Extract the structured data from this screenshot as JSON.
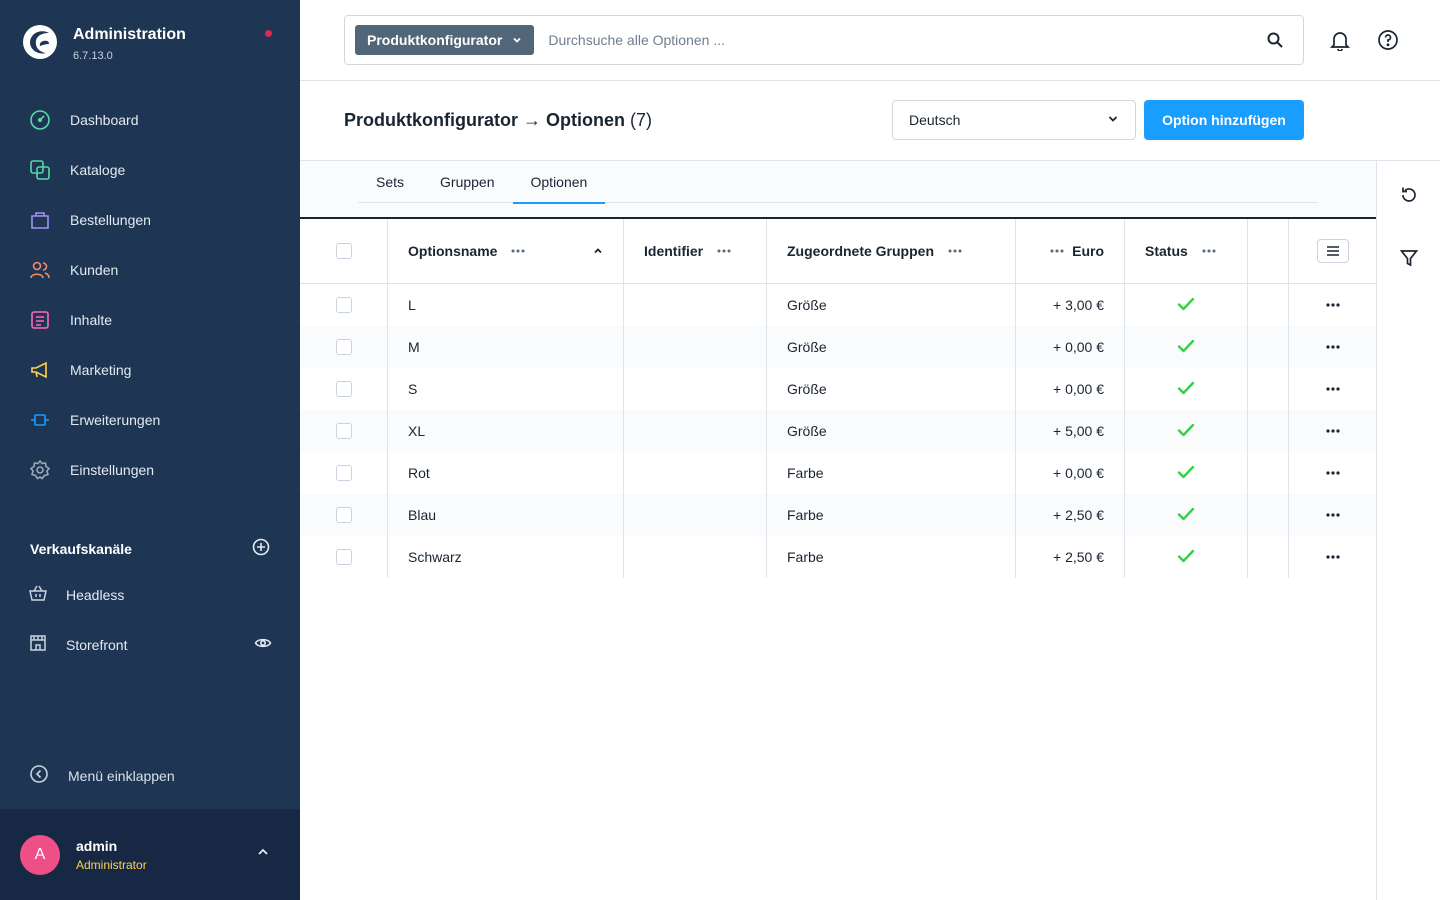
{
  "app": {
    "title": "Administration",
    "version": "6.7.13.0"
  },
  "nav": [
    {
      "label": "Dashboard",
      "icon": "dashboard-icon",
      "color": "#57d9a3"
    },
    {
      "label": "Kataloge",
      "icon": "catalog-icon",
      "color": "#57d9a3"
    },
    {
      "label": "Bestellungen",
      "icon": "orders-icon",
      "color": "#a092f0"
    },
    {
      "label": "Kunden",
      "icon": "customers-icon",
      "color": "#f88962"
    },
    {
      "label": "Inhalte",
      "icon": "content-icon",
      "color": "#ff68b4"
    },
    {
      "label": "Marketing",
      "icon": "marketing-icon",
      "color": "#ffd24a"
    },
    {
      "label": "Erweiterungen",
      "icon": "extensions-icon",
      "color": "#189eff"
    },
    {
      "label": "Einstellungen",
      "icon": "settings-icon",
      "color": "#9aa8b5"
    }
  ],
  "sales_channels": {
    "title": "Verkaufskanäle",
    "items": [
      {
        "label": "Headless"
      },
      {
        "label": "Storefront"
      }
    ]
  },
  "collapse_label": "Menü einklappen",
  "user": {
    "initial": "A",
    "name": "admin",
    "role": "Administrator"
  },
  "search": {
    "type_label": "Produktkonfigurator",
    "placeholder": "Durchsuche alle Optionen ..."
  },
  "page": {
    "title": "Produktkonfigurator → Optionen",
    "count": "(7)",
    "language": "Deutsch",
    "add_button": "Option hinzufügen"
  },
  "tabs": [
    {
      "label": "Sets",
      "active": false
    },
    {
      "label": "Gruppen",
      "active": false
    },
    {
      "label": "Optionen",
      "active": true
    }
  ],
  "table": {
    "columns": {
      "name": "Optionsname",
      "identifier": "Identifier",
      "groups": "Zugeordnete Gruppen",
      "price": "Euro",
      "status": "Status"
    },
    "rows": [
      {
        "name": "L",
        "identifier": "",
        "group": "Größe",
        "price": "+ 3,00 €",
        "active": true
      },
      {
        "name": "M",
        "identifier": "",
        "group": "Größe",
        "price": "+ 0,00 €",
        "active": true
      },
      {
        "name": "S",
        "identifier": "",
        "group": "Größe",
        "price": "+ 0,00 €",
        "active": true
      },
      {
        "name": "XL",
        "identifier": "",
        "group": "Größe",
        "price": "+ 5,00 €",
        "active": true
      },
      {
        "name": "Rot",
        "identifier": "",
        "group": "Farbe",
        "price": "+ 0,00 €",
        "active": true
      },
      {
        "name": "Blau",
        "identifier": "",
        "group": "Farbe",
        "price": "+ 2,50 €",
        "active": true
      },
      {
        "name": "Schwarz",
        "identifier": "",
        "group": "Farbe",
        "price": "+ 2,50 €",
        "active": true
      }
    ]
  },
  "colors": {
    "sidebar": "#1f3554",
    "primary": "#189eff",
    "success": "#37d046"
  }
}
